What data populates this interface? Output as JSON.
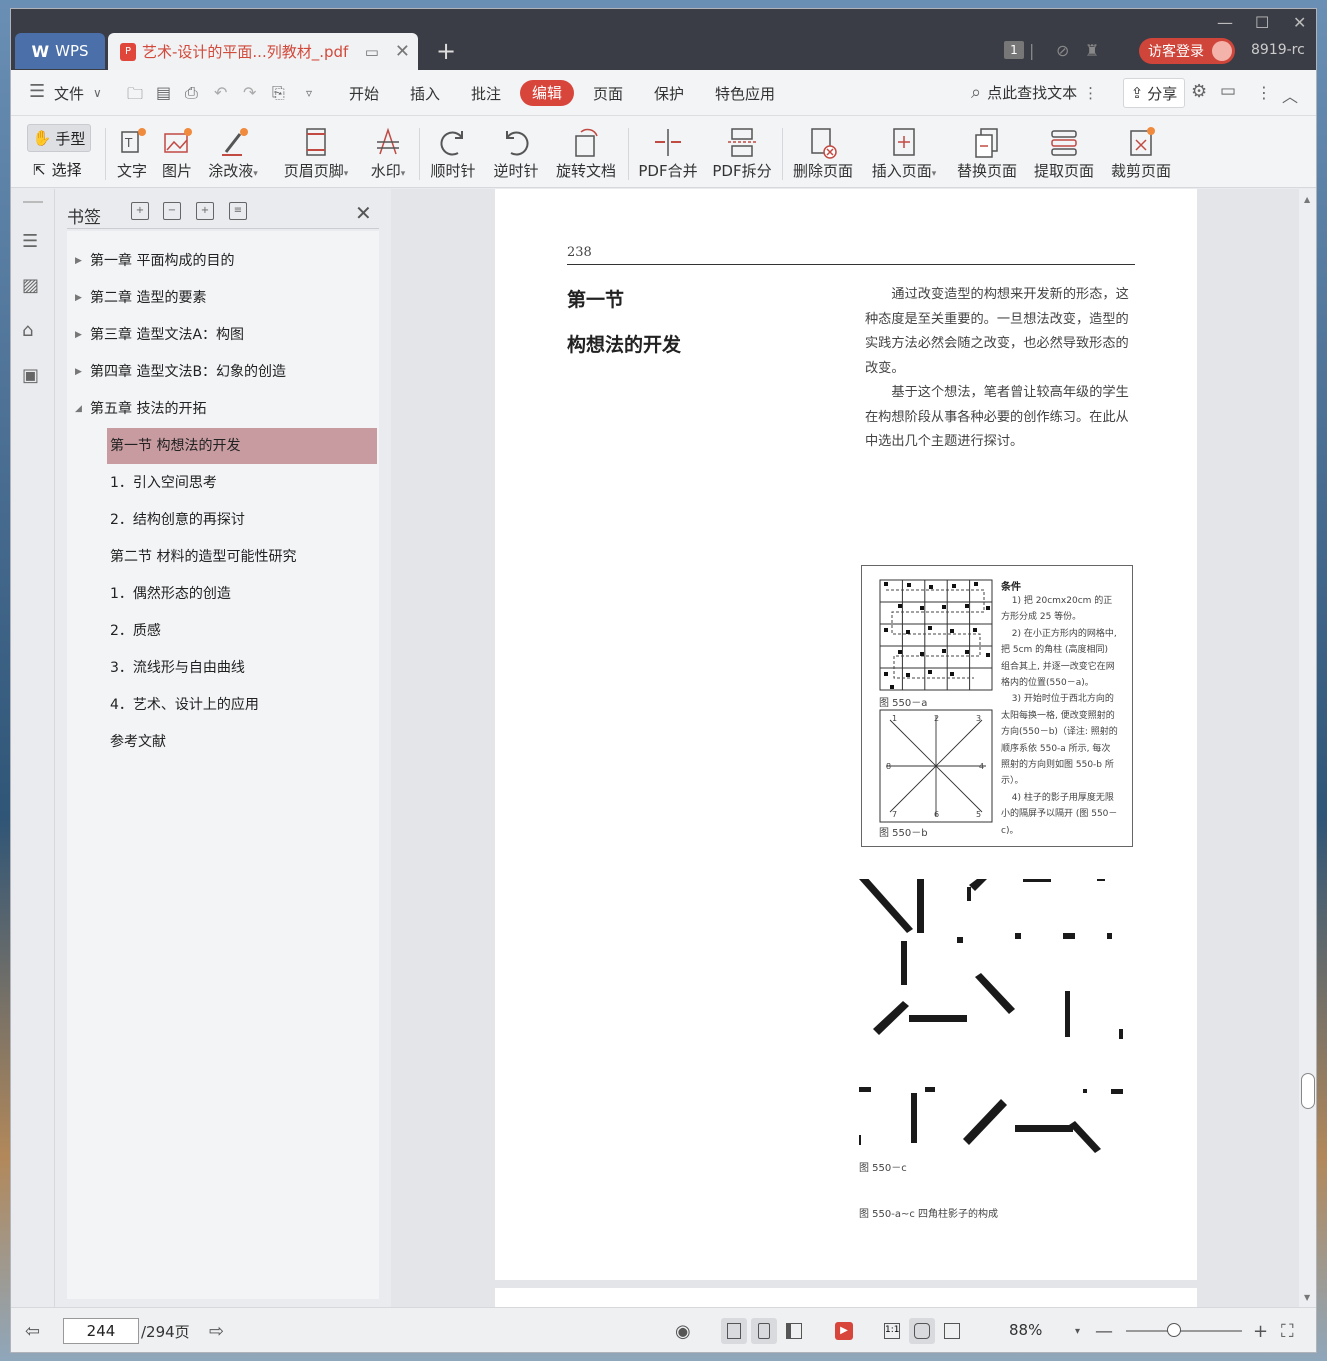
{
  "app": {
    "name": "WPS"
  },
  "tab": {
    "title": "艺术-设计的平面...列教材_.pdf"
  },
  "header": {
    "login_label": "访客登录",
    "user_code": "8919-rc",
    "count_badge": "1"
  },
  "menu": {
    "file": "文件",
    "items": [
      "开始",
      "插入",
      "批注",
      "编辑",
      "页面",
      "保护",
      "特色应用"
    ],
    "active": "编辑",
    "search": "点此查找文本",
    "share": "分享"
  },
  "toolbar": {
    "hand": "手型",
    "select": "选择",
    "tools": [
      "文字",
      "图片",
      "涂改液",
      "页眉页脚",
      "水印",
      "顺时针",
      "逆时针",
      "旋转文档",
      "PDF合并",
      "PDF拆分",
      "删除页面",
      "插入页面",
      "替换页面",
      "提取页面",
      "裁剪页面"
    ]
  },
  "sidebar": {
    "title": "书签",
    "items": [
      {
        "label": "第一章  平面构成的目的",
        "level": 0,
        "expandable": true
      },
      {
        "label": "第二章  造型的要素",
        "level": 0,
        "expandable": true
      },
      {
        "label": "第三章  造型文法A：构图",
        "level": 0,
        "expandable": true
      },
      {
        "label": "第四章  造型文法B：幻象的创造",
        "level": 0,
        "expandable": true
      },
      {
        "label": "第五章  技法的开拓",
        "level": 0,
        "expandable": true,
        "expanded": true
      },
      {
        "label": "第一节  构想法的开发",
        "level": 1,
        "selected": true
      },
      {
        "label": "1．引入空间思考",
        "level": 1
      },
      {
        "label": "2．结构创意的再探讨",
        "level": 1
      },
      {
        "label": "第二节  材料的造型可能性研究",
        "level": 1
      },
      {
        "label": "1．偶然形态的创造",
        "level": 1
      },
      {
        "label": "2．质感",
        "level": 1
      },
      {
        "label": "3．流线形与自由曲线",
        "level": 1
      },
      {
        "label": "4．艺术、设计上的应用",
        "level": 1
      },
      {
        "label": "参考文献",
        "level": 1
      }
    ]
  },
  "page": {
    "number": "238",
    "section": "第一节",
    "heading": "构想法的开发",
    "paragraphs": [
      "通过改变造型的构想来开发新的形态，这种态度是至关重要的。一旦想法改变，造型的实践方法必然会随之改变，也必然导致形态的改变。",
      "基于这个想法，笔者曾让较高年级的学生在构想阶段从事各种必要的创作练习。在此从中选出几个主题进行探讨。"
    ],
    "conditions_title": "条件",
    "conditions": [
      "1) 把 20cmx20cm 的正方形分成 25 等份。",
      "2) 在小正方形内的网格中, 把 5cm 的角柱 (高度相同) 组合其上, 并逐一改变它在网格内的位置(550－a)。",
      "3) 开始时位于西北方向的太阳每换一格, 便改变照射的方向(550－b)（译注: 照射的顺序系依 550-a 所示, 每次照射的方向则如图 550-b 所示）。",
      "4) 柱子的影子用厚度无限小的隔屏予以隔开 (图 550－c)。"
    ],
    "fig_a": "图 550－a",
    "fig_b": "图 550－b",
    "fig_c": "图 550－c",
    "caption": "图 550-a~c  四角柱影子的构成",
    "dial_numbers": [
      "1",
      "2",
      "3",
      "4",
      "5",
      "6",
      "7",
      "8"
    ]
  },
  "status": {
    "current_page": "244",
    "total_pages": "/294页",
    "zoom": "88%"
  }
}
